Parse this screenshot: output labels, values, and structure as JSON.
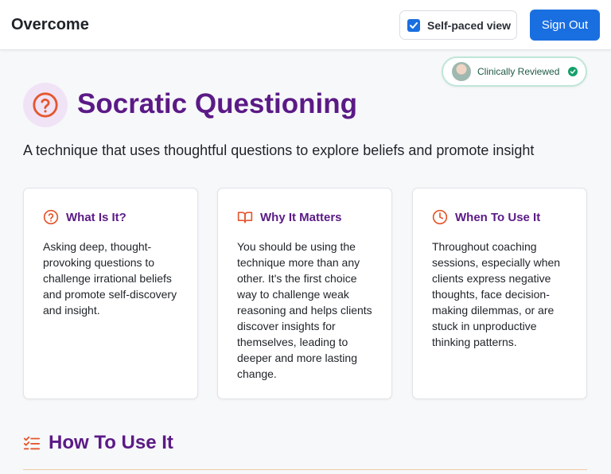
{
  "header": {
    "brand": "Overcome",
    "self_paced_label": "Self-paced view",
    "self_paced_checked": true,
    "sign_out_label": "Sign Out"
  },
  "badge": {
    "label": "Clinically Reviewed",
    "icon": "check-circle-icon"
  },
  "page": {
    "title": "Socratic Questioning",
    "title_icon": "question-circle-icon",
    "subtitle": "A technique that uses thoughtful questions to explore beliefs and promote insight"
  },
  "cards": [
    {
      "icon": "question-circle-icon",
      "title": "What Is It?",
      "body": "Asking deep, thought-provoking questions to challenge irrational beliefs and promote self-discovery and insight."
    },
    {
      "icon": "open-book-icon",
      "title": "Why It Matters",
      "body": "You should be using the technique more than any other. It's the first choice way to challenge weak reasoning and helps clients discover insights for themselves, leading to deeper and more lasting change."
    },
    {
      "icon": "clock-icon",
      "title": "When To Use It",
      "body": "Throughout coaching sessions, especially when clients express negative thoughts, face decision-making dilemmas, or are stuck in unproductive thinking patterns."
    }
  ],
  "section": {
    "title": "How To Use It",
    "icon": "checklist-icon"
  },
  "colors": {
    "accent_purple": "#5b1a86",
    "accent_orange": "#e4572e",
    "primary_blue": "#1a6fe0",
    "reviewed_green": "#14a06a"
  }
}
